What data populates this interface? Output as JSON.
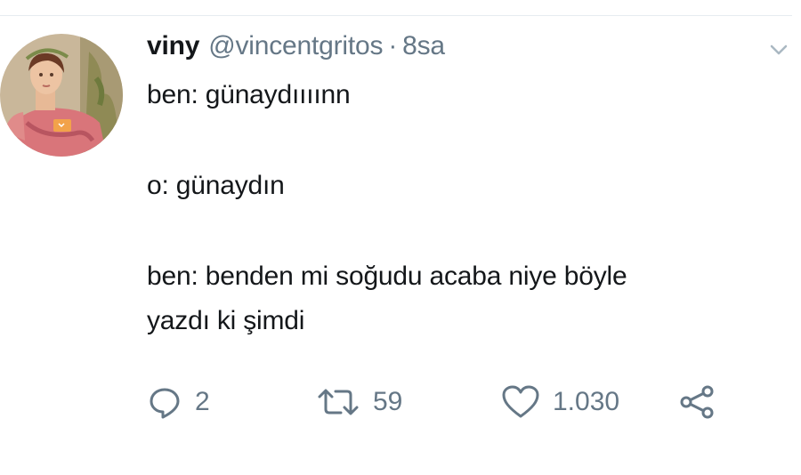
{
  "tweet": {
    "author": {
      "display_name": "viny",
      "handle": "@vincentgritos",
      "separator": "·",
      "time": "8sa",
      "avatar_icon": "avatar-painting"
    },
    "lines": [
      "ben: günaydıııınn",
      "",
      "o: günaydın",
      "",
      "ben: benden mi soğudu acaba niye böyle",
      "yazdı ki şimdi"
    ],
    "actions": {
      "reply": {
        "icon": "reply-icon",
        "count": "2"
      },
      "retweet": {
        "icon": "retweet-icon",
        "count": "59"
      },
      "like": {
        "icon": "heart-icon",
        "count": "1.030"
      },
      "share": {
        "icon": "share-icon"
      }
    },
    "menu_icon": "chevron-down-icon"
  },
  "colors": {
    "text_primary": "#14171a",
    "text_secondary": "#657786",
    "divider": "#e6ecf0"
  }
}
